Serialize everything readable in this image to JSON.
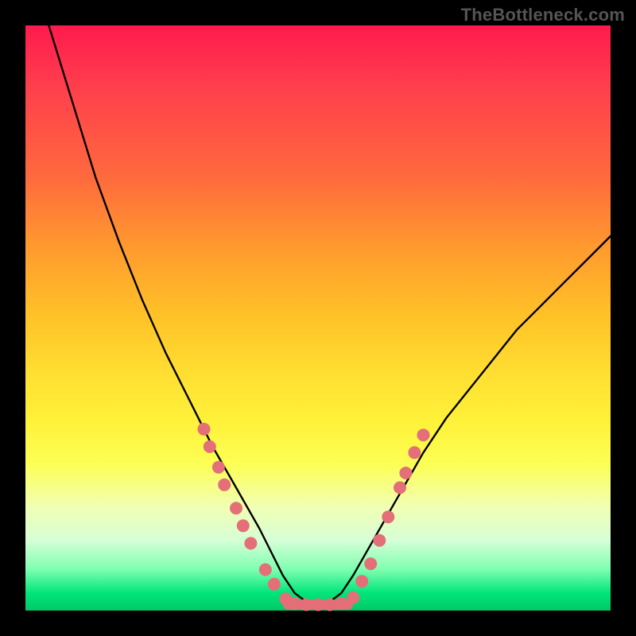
{
  "watermark": "TheBottleneck.com",
  "chart_data": {
    "type": "line",
    "title": "",
    "xlabel": "",
    "ylabel": "",
    "xlim": [
      0,
      100
    ],
    "ylim": [
      0,
      100
    ],
    "grid": false,
    "legend": false,
    "series": [
      {
        "name": "bottleneck-curve",
        "x": [
          0,
          4,
          8,
          12,
          16,
          20,
          24,
          28,
          32,
          36,
          40,
          42,
          44,
          46,
          48,
          50,
          52,
          54,
          56,
          60,
          64,
          68,
          72,
          76,
          80,
          84,
          88,
          92,
          96,
          100
        ],
        "values": [
          115,
          100,
          87,
          74,
          63,
          53,
          44,
          36,
          28,
          21,
          14,
          10,
          6,
          3,
          1.5,
          1,
          1.5,
          3,
          6,
          13,
          20,
          27,
          33,
          38,
          43,
          48,
          52,
          56,
          60,
          64
        ]
      }
    ],
    "markers": {
      "name": "highlight-dots",
      "color": "#e46f78",
      "radius": 8,
      "points": [
        {
          "x": 30.5,
          "y": 31
        },
        {
          "x": 31.5,
          "y": 28
        },
        {
          "x": 33.0,
          "y": 24.5
        },
        {
          "x": 34.0,
          "y": 21.5
        },
        {
          "x": 36.0,
          "y": 17.5
        },
        {
          "x": 37.2,
          "y": 14.5
        },
        {
          "x": 38.5,
          "y": 11.5
        },
        {
          "x": 41.0,
          "y": 7
        },
        {
          "x": 42.5,
          "y": 4.5
        },
        {
          "x": 44.5,
          "y": 2
        },
        {
          "x": 46.0,
          "y": 1.2
        },
        {
          "x": 48.0,
          "y": 1
        },
        {
          "x": 50.0,
          "y": 1
        },
        {
          "x": 52.0,
          "y": 1
        },
        {
          "x": 54.0,
          "y": 1.2
        },
        {
          "x": 56.0,
          "y": 2.2
        },
        {
          "x": 57.5,
          "y": 5
        },
        {
          "x": 59.0,
          "y": 8
        },
        {
          "x": 60.5,
          "y": 12
        },
        {
          "x": 62.0,
          "y": 16
        },
        {
          "x": 64.0,
          "y": 21
        },
        {
          "x": 65.0,
          "y": 23.5
        },
        {
          "x": 66.5,
          "y": 27
        },
        {
          "x": 68.0,
          "y": 30
        }
      ]
    },
    "flat_bar": {
      "color": "#e46f78",
      "x_start": 44,
      "x_end": 56,
      "y": 1,
      "thickness": 12
    }
  }
}
